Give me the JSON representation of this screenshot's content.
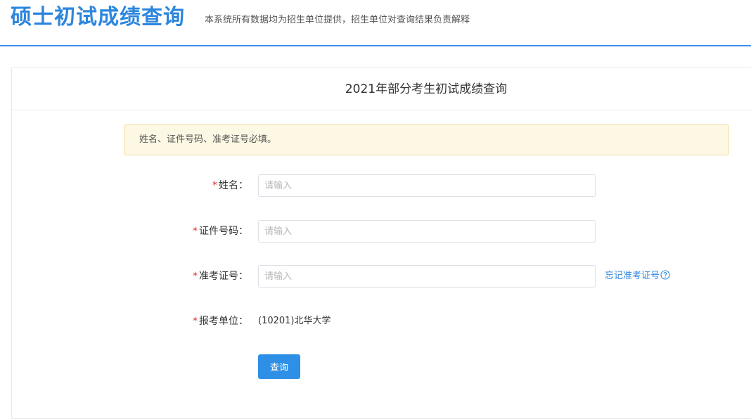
{
  "header": {
    "title": "硕士初试成绩查询",
    "subtitle": "本系统所有数据均为招生单位提供，招生单位对查询结果负责解释"
  },
  "panel": {
    "title": "2021年部分考生初试成绩查询"
  },
  "notice": {
    "text": "姓名、证件号码、准考证号必填。"
  },
  "form": {
    "required_mark": "*",
    "name": {
      "label": "姓名：",
      "placeholder": "请输入",
      "value": ""
    },
    "id_number": {
      "label": "证件号码：",
      "placeholder": "请输入",
      "value": ""
    },
    "exam_number": {
      "label": "准考证号：",
      "placeholder": "请输入",
      "value": "",
      "forgot_link": "忘记准考证号",
      "help_icon": "question-circle-icon"
    },
    "institution": {
      "label": "报考单位：",
      "value": "(10201)北华大学"
    },
    "submit_label": "查询"
  },
  "colors": {
    "brand_blue": "#2d86dd",
    "button_blue": "#2d8fe6",
    "required_red": "#e0332e",
    "notice_bg": "#fdf8e4",
    "notice_border": "#f4dfa6"
  }
}
